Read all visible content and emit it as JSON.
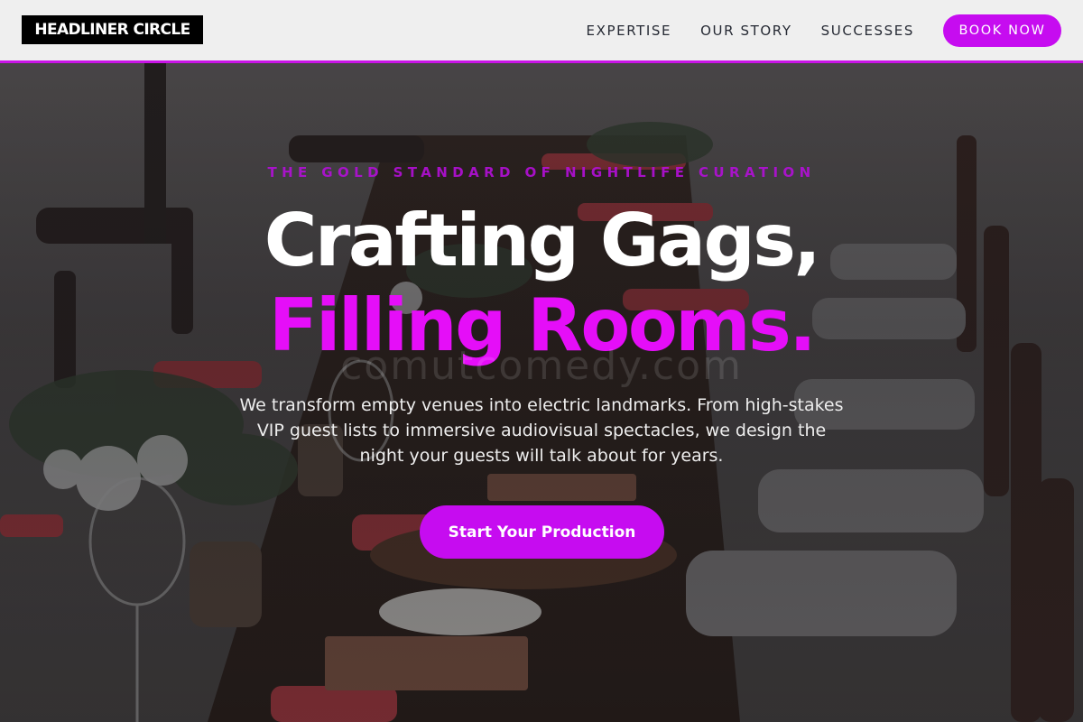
{
  "nav": {
    "logo": "HEADLINER CIRCLE",
    "links": [
      "EXPERTISE",
      "OUR STORY",
      "SUCCESSES"
    ],
    "cta": "BOOK NOW"
  },
  "hero": {
    "eyebrow": "THE GOLD STANDARD OF NIGHTLIFE CURATION",
    "headline_line1": "Crafting Gags,",
    "headline_line2": "Filling Rooms.",
    "watermark": "comutcomedy.com",
    "subtext": "We transform empty venues into electric landmarks. From high-stakes VIP guest lists to immersive audiovisual spectacles, we design the night your guests will talk about for years.",
    "cta": "Start Your Production",
    "background_image": "banquet-table-with-wooden-chairs"
  },
  "colors": {
    "accent": "#c60cf0",
    "headline_accent": "#e50ef8",
    "nav_bg": "#f5f5f5",
    "logo_bg": "#000000"
  }
}
